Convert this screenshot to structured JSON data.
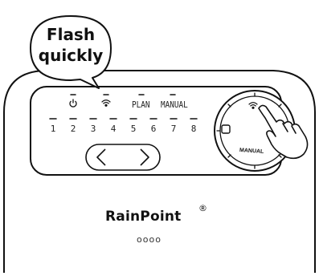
{
  "callout": {
    "line1": "Flash",
    "line2": "quickly"
  },
  "status_labels": {
    "plan": "PLAN",
    "manual": "MANUAL"
  },
  "zones": [
    "1",
    "2",
    "3",
    "4",
    "5",
    "6",
    "7",
    "8"
  ],
  "knob": {
    "label": "MANUAL"
  },
  "brand": {
    "name": "RainPoint",
    "mark": "®"
  },
  "bottom_indicator": "oooo",
  "icons": [
    "power-icon",
    "wifi-icon",
    "left-arrow-icon",
    "right-arrow-icon",
    "hand-pointer-icon",
    "stop-icon"
  ]
}
